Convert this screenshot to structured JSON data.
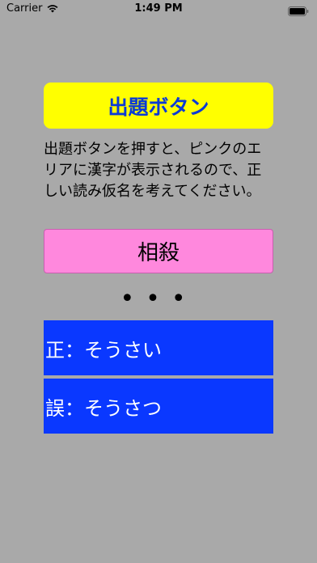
{
  "status_bar": {
    "carrier": "Carrier",
    "time": "1:49 PM"
  },
  "question_button_label": "出題ボタン",
  "instructions": "出題ボタンを押すと、ピンクのエリアに漢字が表示されるので、正しい読み仮名を考えてください。",
  "kanji": "相殺",
  "dots": "•••",
  "answers": {
    "correct": "正：そうさい",
    "wrong": "誤：そうさつ"
  }
}
